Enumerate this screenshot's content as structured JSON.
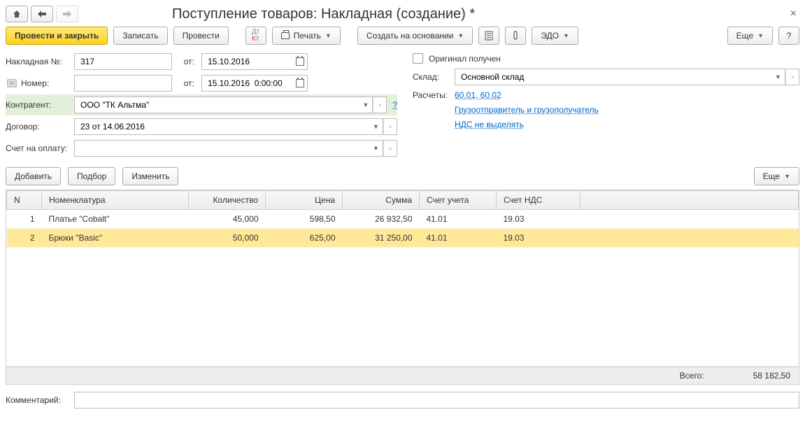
{
  "title": "Поступление товаров: Накладная (создание) *",
  "toolbar": {
    "post_close": "Провести и закрыть",
    "save": "Записать",
    "post": "Провести",
    "print": "Печать",
    "create_based": "Создать на основании",
    "edo": "ЭДО",
    "more": "Еще",
    "help": "?"
  },
  "fields": {
    "invoice_no_lbl": "Накладная №:",
    "invoice_no": "317",
    "from1_lbl": "от:",
    "from1": "15.10.2016",
    "number_lbl": "Номер:",
    "number": "",
    "from2_lbl": "от:",
    "from2": "15.10.2016  0:00:00",
    "contractor_lbl": "Контрагент:",
    "contractor": "ООО \"ТК Альтма\"",
    "contract_lbl": "Договор:",
    "contract": "23 от 14.06.2016",
    "account_lbl": "Счет на оплату:",
    "account": "",
    "original_lbl": "Оригинал получен",
    "warehouse_lbl": "Склад:",
    "warehouse": "Основной склад",
    "calc_lbl": "Расчеты:",
    "calc_link": "60.01, 60.02",
    "shipper_link": "Грузоотправитель и грузополучатель",
    "vat_link": "НДС не выделять",
    "help_q": "?"
  },
  "table_toolbar": {
    "add": "Добавить",
    "pick": "Подбор",
    "change": "Изменить",
    "more": "Еще"
  },
  "columns": {
    "n": "N",
    "nom": "Номенклатура",
    "qty": "Количество",
    "price": "Цена",
    "sum": "Сумма",
    "acc": "Счет учета",
    "vat": "Счет НДС"
  },
  "rows": [
    {
      "n": "1",
      "nom": "Платье \"Cobalt\"",
      "qty": "45,000",
      "price": "598,50",
      "sum": "26 932,50",
      "acc": "41.01",
      "vat": "19.03"
    },
    {
      "n": "2",
      "nom": "Брюки \"Basic\"",
      "qty": "50,000",
      "price": "625,00",
      "sum": "31 250,00",
      "acc": "41.01",
      "vat": "19.03"
    }
  ],
  "total_lbl": "Всего:",
  "total": "58 182,50",
  "comment_lbl": "Комментарий:",
  "comment": ""
}
